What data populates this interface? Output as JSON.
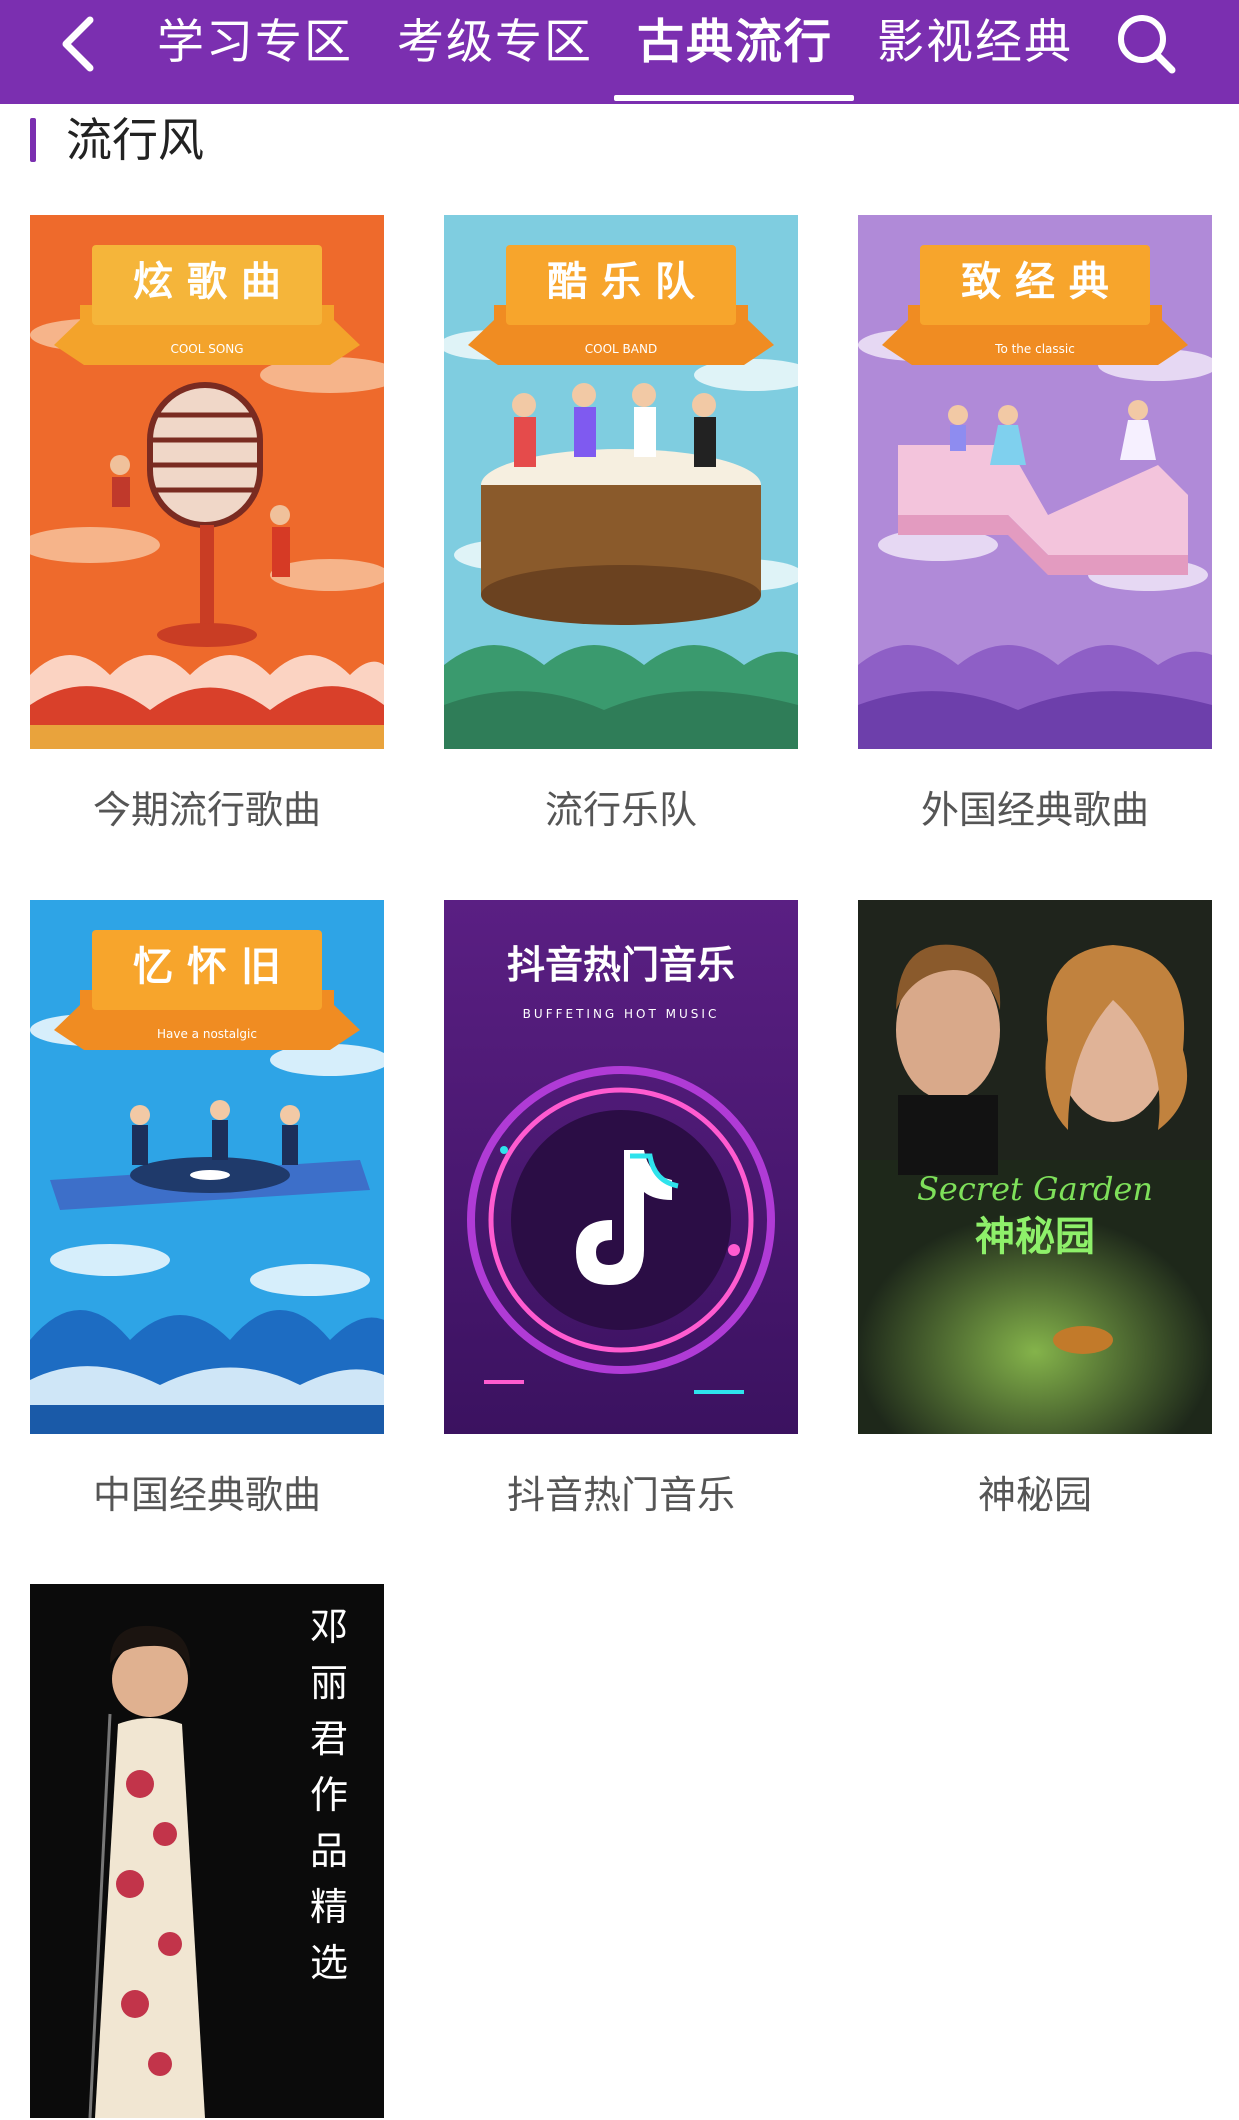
{
  "header": {
    "back_icon": "chevron-left-icon",
    "search_icon": "search-icon",
    "tabs": [
      {
        "label": "学习专区"
      },
      {
        "label": "考级专区"
      },
      {
        "label": "古典流行",
        "active": true
      },
      {
        "label": "影视经典"
      }
    ],
    "accent_color": "#7b2fb0"
  },
  "section": {
    "title": "流行风"
  },
  "cards": [
    {
      "caption": "今期流行歌曲",
      "cover_banner": "炫 歌 曲",
      "cover_sub": "COOL SONG"
    },
    {
      "caption": "流行乐队",
      "cover_banner": "酷 乐 队",
      "cover_sub": "COOL BAND"
    },
    {
      "caption": "外国经典歌曲",
      "cover_banner": "致 经 典",
      "cover_sub": "To the classic"
    },
    {
      "caption": "中国经典歌曲",
      "cover_banner": "忆 怀 旧",
      "cover_sub": "Have a nostalgic"
    },
    {
      "caption": "抖音热门音乐",
      "cover_banner": "抖音热门音乐",
      "cover_sub": "BUFFETING HOT MUSIC"
    },
    {
      "caption": "神秘园",
      "cover_banner": "Secret Garden",
      "cover_sub": "神秘园"
    },
    {
      "caption": "",
      "cover_banner": "邓丽君作品精选",
      "cover_sub": ""
    }
  ]
}
